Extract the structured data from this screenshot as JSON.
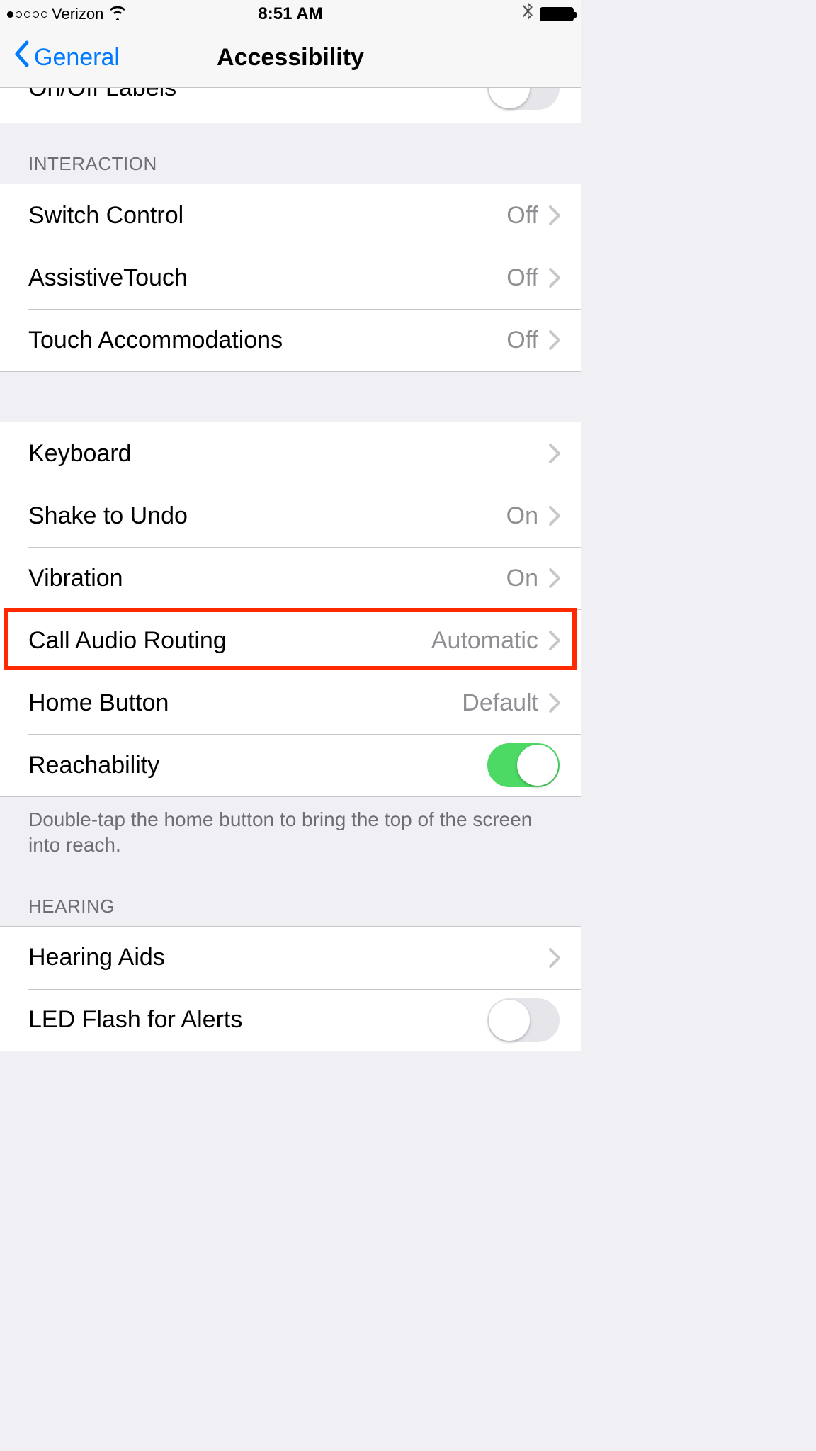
{
  "status": {
    "carrier": "Verizon",
    "time": "8:51 AM"
  },
  "nav": {
    "back": "General",
    "title": "Accessibility"
  },
  "partial": {
    "onoff_labels": "On/Off Labels"
  },
  "sections": {
    "interaction": {
      "header": "INTERACTION",
      "items": [
        {
          "label": "Switch Control",
          "value": "Off"
        },
        {
          "label": "AssistiveTouch",
          "value": "Off"
        },
        {
          "label": "Touch Accommodations",
          "value": "Off"
        }
      ]
    },
    "interaction2": {
      "items": [
        {
          "label": "Keyboard",
          "value": ""
        },
        {
          "label": "Shake to Undo",
          "value": "On"
        },
        {
          "label": "Vibration",
          "value": "On"
        },
        {
          "label": "Call Audio Routing",
          "value": "Automatic"
        },
        {
          "label": "Home Button",
          "value": "Default"
        },
        {
          "label": "Reachability",
          "toggle": true
        }
      ],
      "footer": "Double-tap the home button to bring the top of the screen into reach."
    },
    "hearing": {
      "header": "HEARING",
      "items": [
        {
          "label": "Hearing Aids",
          "value": ""
        },
        {
          "label": "LED Flash for Alerts",
          "toggle": false
        }
      ]
    }
  },
  "highlight_row_index": 3
}
